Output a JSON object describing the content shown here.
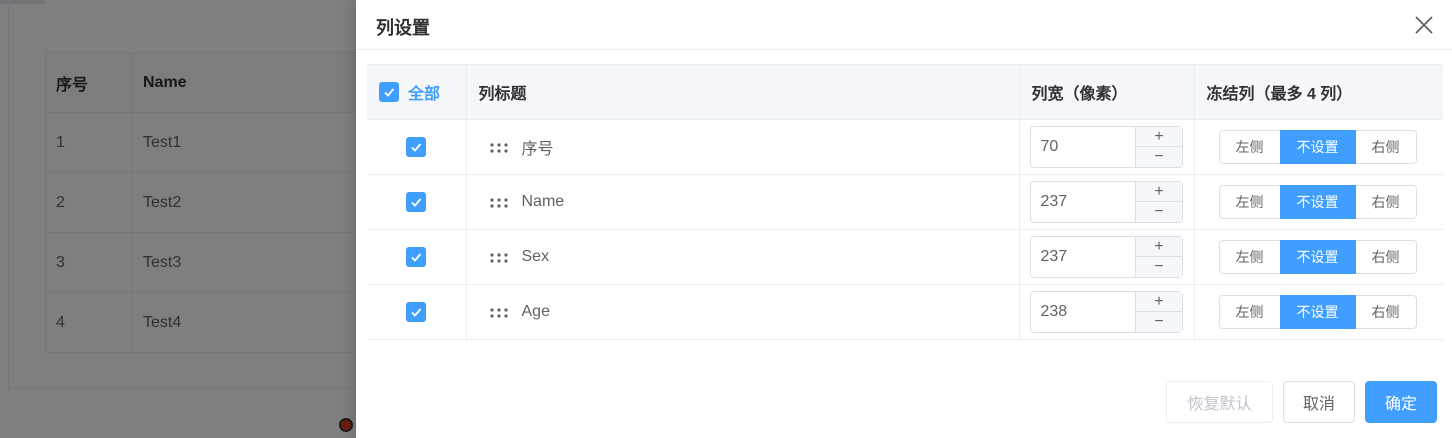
{
  "background": {
    "headers": [
      "序号",
      "Name"
    ],
    "rows": [
      [
        "1",
        "Test1"
      ],
      [
        "2",
        "Test2"
      ],
      [
        "3",
        "Test3"
      ],
      [
        "4",
        "Test4"
      ]
    ]
  },
  "drawer": {
    "title": "列设置",
    "close_icon": "close-icon",
    "table": {
      "select_all_label": "全部",
      "select_all_checked": true,
      "headers": {
        "title": "列标题",
        "width": "列宽（像素）",
        "freeze": "冻结列（最多 4 列）"
      },
      "rows": [
        {
          "checked": true,
          "label": "序号",
          "width": "70"
        },
        {
          "checked": true,
          "label": "Name",
          "width": "237"
        },
        {
          "checked": true,
          "label": "Sex",
          "width": "237"
        },
        {
          "checked": true,
          "label": "Age",
          "width": "238"
        }
      ],
      "stepper": {
        "increase": "+",
        "decrease": "−"
      },
      "freeze_options": [
        "左侧",
        "不设置",
        "右侧"
      ],
      "freeze_selected": "不设置"
    },
    "footer": {
      "reset_label": "恢复默认",
      "cancel_label": "取消",
      "ok_label": "确定"
    }
  },
  "colors": {
    "primary": "#409eff",
    "overlay": "rgba(0,0,0,0.5)",
    "border": "#ebeef5"
  }
}
